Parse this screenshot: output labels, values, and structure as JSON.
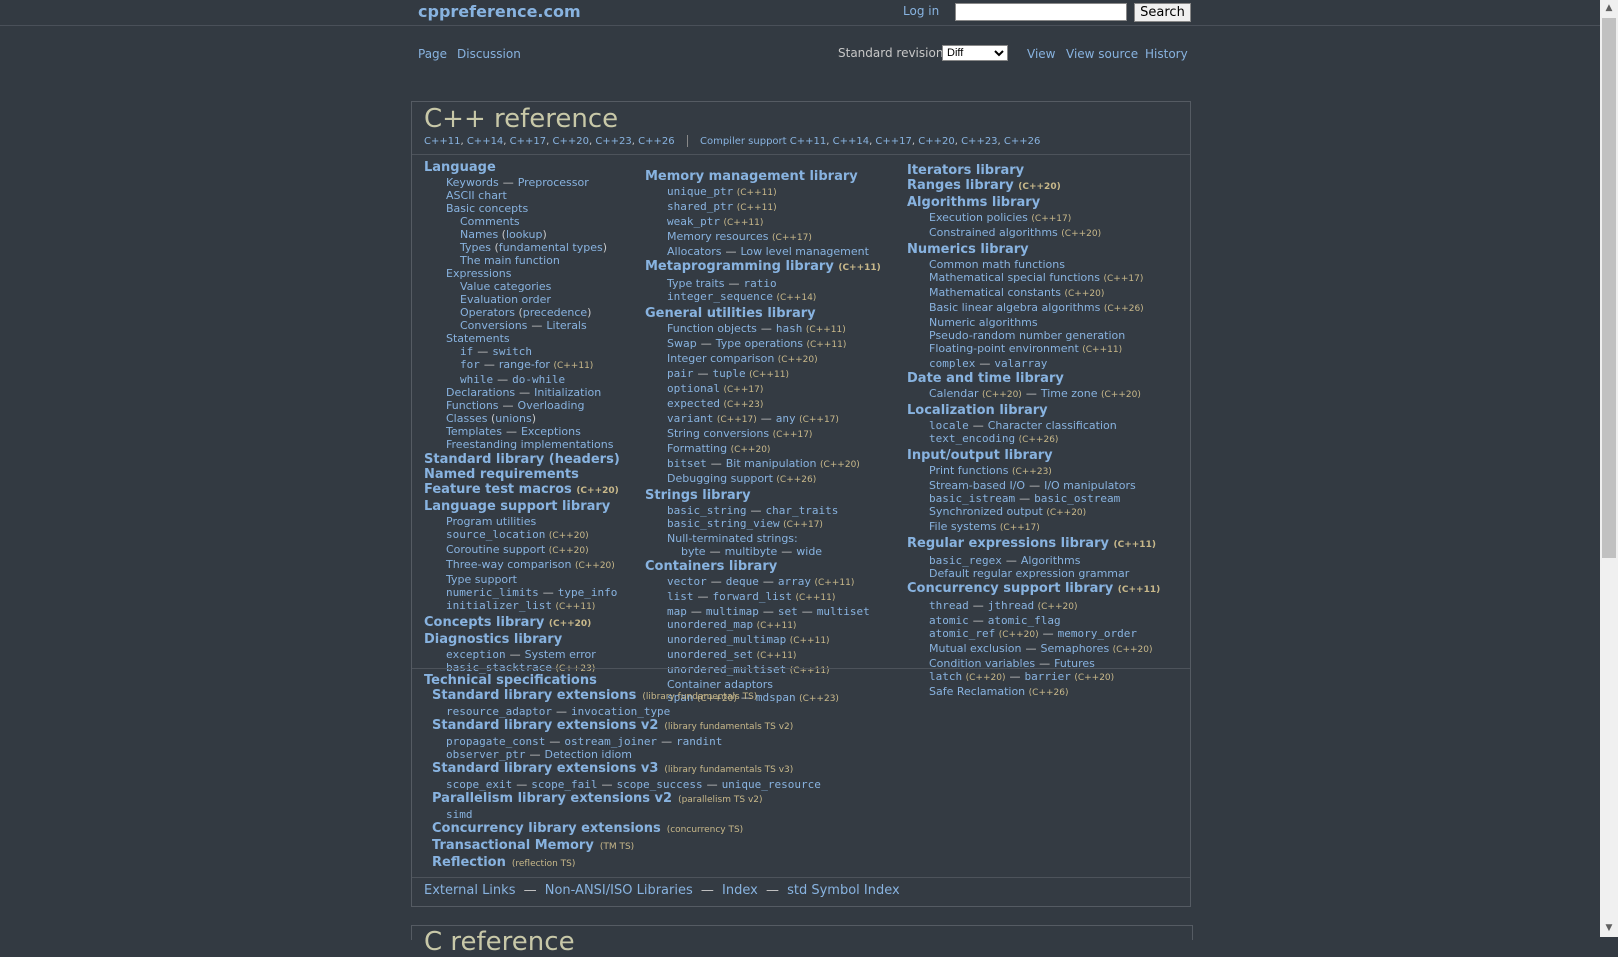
{
  "topbar": {
    "site_title": "cppreference.com",
    "login": "Log in",
    "search_placeholder": "",
    "search_button": "Search"
  },
  "nav": {
    "page": "Page",
    "discussion": "Discussion",
    "std_label": "Standard revision:",
    "std_value": "Diff",
    "view": "View",
    "view_source": "View source",
    "history": "History"
  },
  "main": {
    "title": "C++ reference",
    "revisions": [
      "C++11",
      "C++14",
      "C++17",
      "C++20",
      "C++23",
      "C++26"
    ],
    "compiler_support_label": "Compiler support",
    "compiler_support": [
      "C++11",
      "C++14",
      "C++17",
      "C++20",
      "C++23",
      "C++26"
    ]
  },
  "col1": {
    "language": "Language",
    "keywords": "Keywords",
    "preprocessor": "Preprocessor",
    "ascii": "ASCII chart",
    "basic_concepts": "Basic concepts",
    "comments": "Comments",
    "names": "Names",
    "lookup": "lookup",
    "types": "Types",
    "fundamental_types": "fundamental types",
    "main_function": "The main function",
    "expressions": "Expressions",
    "value_categories": "Value categories",
    "evaluation_order": "Evaluation order",
    "operators": "Operators",
    "precedence": "precedence",
    "conversions": "Conversions",
    "literals": "Literals",
    "statements": "Statements",
    "if": "if",
    "switch": "switch",
    "for": "for",
    "range_for": "range-for",
    "while": "while",
    "do_while": "do-while",
    "declarations": "Declarations",
    "initialization": "Initialization",
    "functions": "Functions",
    "overloading": "Overloading",
    "classes": "Classes",
    "unions": "unions",
    "templates": "Templates",
    "exceptions": "Exceptions",
    "freestanding": "Freestanding implementations",
    "standard_library": "Standard library",
    "headers": "headers",
    "named_requirements": "Named requirements",
    "feature_test": "Feature test macros",
    "lang_support": "Language support library",
    "program_utilities": "Program utilities",
    "source_location": "source_location",
    "coroutine_support": "Coroutine support",
    "three_way": "Three-way comparison",
    "type_support": "Type support",
    "numeric_limits": "numeric_limits",
    "type_info": "type_info",
    "initializer_list": "initializer_list",
    "concepts": "Concepts library",
    "diagnostics": "Diagnostics library",
    "exception": "exception",
    "system_error": "System error",
    "basic_stacktrace": "basic_stacktrace"
  },
  "col2": {
    "memory": "Memory management library",
    "unique_ptr": "unique_ptr",
    "shared_ptr": "shared_ptr",
    "weak_ptr": "weak_ptr",
    "memory_resources": "Memory resources",
    "allocators": "Allocators",
    "low_level": "Low level management",
    "metaprogramming": "Metaprogramming library",
    "type_traits": "Type traits",
    "ratio": "ratio",
    "integer_sequence": "integer_sequence",
    "general_utilities": "General utilities library",
    "function_objects": "Function objects",
    "hash": "hash",
    "swap": "Swap",
    "type_operations": "Type operations",
    "integer_comparison": "Integer comparison",
    "pair": "pair",
    "tuple": "tuple",
    "optional": "optional",
    "expected": "expected",
    "variant": "variant",
    "any": "any",
    "string_conversions": "String conversions",
    "formatting": "Formatting",
    "bitset": "bitset",
    "bit_manipulation": "Bit manipulation",
    "debugging_support": "Debugging support",
    "strings": "Strings library",
    "basic_string": "basic_string",
    "char_traits": "char_traits",
    "basic_string_view": "basic_string_view",
    "null_terminated": "Null-terminated strings:",
    "byte": "byte",
    "multibyte": "multibyte",
    "wide": "wide",
    "containers": "Containers library",
    "vector": "vector",
    "deque": "deque",
    "array": "array",
    "list": "list",
    "forward_list": "forward_list",
    "map": "map",
    "multimap": "multimap",
    "set": "set",
    "multiset": "multiset",
    "unordered_map": "unordered_map",
    "unordered_multimap": "unordered_multimap",
    "unordered_set": "unordered_set",
    "unordered_multiset": "unordered_multiset",
    "container_adaptors": "Container adaptors",
    "span": "span",
    "mdspan": "mdspan"
  },
  "col3": {
    "iterators": "Iterators library",
    "ranges": "Ranges library",
    "algorithms": "Algorithms library",
    "execution_policies": "Execution policies",
    "constrained_algorithms": "Constrained algorithms",
    "numerics": "Numerics library",
    "common_math": "Common math functions",
    "special_functions": "Mathematical special functions",
    "math_constants": "Mathematical constants",
    "linear_algebra": "Basic linear algebra algorithms",
    "numeric_algorithms": "Numeric algorithms",
    "prng": "Pseudo-random number generation",
    "fp_env": "Floating-point environment",
    "complex": "complex",
    "valarray": "valarray",
    "date_time": "Date and time library",
    "calendar": "Calendar",
    "time_zone": "Time zone",
    "localization": "Localization library",
    "locale": "locale",
    "char_class": "Character classification",
    "text_encoding": "text_encoding",
    "io": "Input/output library",
    "print_functions": "Print functions",
    "stream_io": "Stream-based I/O",
    "io_manipulators": "I/O manipulators",
    "basic_istream": "basic_istream",
    "basic_ostream": "basic_ostream",
    "sync_output": "Synchronized output",
    "file_systems": "File systems",
    "regex": "Regular expressions library",
    "basic_regex": "basic_regex",
    "regex_algorithms": "Algorithms",
    "regex_grammar": "Default regular expression grammar",
    "concurrency": "Concurrency support library",
    "thread": "thread",
    "jthread": "jthread",
    "atomic": "atomic",
    "atomic_flag": "atomic_flag",
    "atomic_ref": "atomic_ref",
    "memory_order": "memory_order",
    "mutual_exclusion": "Mutual exclusion",
    "semaphores": "Semaphores",
    "condition_variables": "Condition variables",
    "futures": "Futures",
    "latch": "latch",
    "barrier": "barrier",
    "safe_reclamation": "Safe Reclamation"
  },
  "tech": {
    "title": "Technical specifications",
    "ext1": "Standard library extensions",
    "ext1_ts": "(library fundamentals TS)",
    "resource_adaptor": "resource_adaptor",
    "invocation_type": "invocation_type",
    "ext2": "Standard library extensions v2",
    "ext2_ts": "(library fundamentals TS v2)",
    "propagate_const": "propagate_const",
    "ostream_joiner": "ostream_joiner",
    "randint": "randint",
    "observer_ptr": "observer_ptr",
    "detection_idiom": "Detection idiom",
    "ext3": "Standard library extensions v3",
    "ext3_ts": "(library fundamentals TS v3)",
    "scope_exit": "scope_exit",
    "scope_fail": "scope_fail",
    "scope_success": "scope_success",
    "unique_resource": "unique_resource",
    "parallelism": "Parallelism library extensions v2",
    "parallelism_ts": "(parallelism TS v2)",
    "simd": "simd",
    "concurrency_ext": "Concurrency library extensions",
    "concurrency_ts": "(concurrency TS)",
    "tm": "Transactional Memory",
    "tm_ts": "(TM TS)",
    "reflection": "Reflection",
    "reflection_ts": "(reflection TS)"
  },
  "footer": {
    "external_links": "External Links",
    "non_ansi": "Non-ANSI/ISO Libraries",
    "index": "Index",
    "std_symbol_index": "std Symbol Index"
  },
  "next_section_title": "C reference",
  "versions": {
    "cpp11": "(C++11)",
    "cpp14": "(C++14)",
    "cpp17": "(C++17)",
    "cpp20": "(C++20)",
    "cpp23": "(C++23)",
    "cpp26": "(C++26)"
  },
  "colors": {
    "background": "#333a42",
    "link": "#88b3e0",
    "text": "#c7c7c7",
    "version": "#c8b88a",
    "title": "#c8c8a8"
  },
  "icons": {
    "scroll_up": "triangle-up",
    "scroll_down": "triangle-down",
    "select_arrow": "chevron-down"
  }
}
